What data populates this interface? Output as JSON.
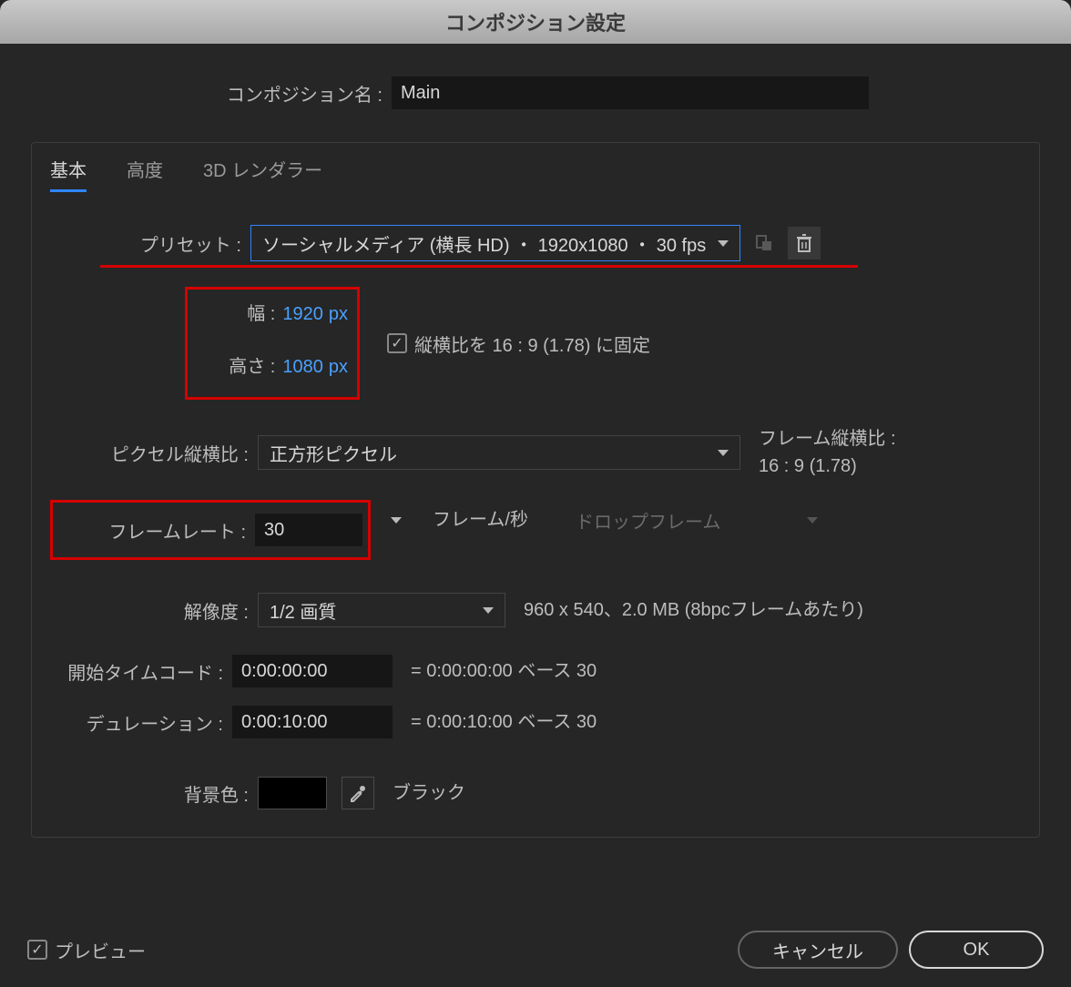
{
  "window": {
    "title": "コンポジション設定"
  },
  "name": {
    "label": "コンポジション名 :",
    "value": "Main"
  },
  "tabs": {
    "basic": "基本",
    "advanced": "高度",
    "threeD": "3D レンダラー"
  },
  "preset": {
    "label": "プリセット :",
    "value": "ソーシャルメディア (横長 HD) ・ 1920x1080 ・ 30 fps"
  },
  "dims": {
    "widthLabel": "幅 :",
    "width": "1920",
    "heightLabel": "高さ :",
    "height": "1080",
    "unit": "px",
    "lockText": "縦横比を 16 : 9 (1.78) に固定"
  },
  "pixelAspect": {
    "label": "ピクセル縦横比 :",
    "value": "正方形ピクセル",
    "infoLabel": "フレーム縦横比 :",
    "infoValue": "16 : 9 (1.78)"
  },
  "frameRate": {
    "label": "フレームレート :",
    "value": "30",
    "fpsLabel": "フレーム/秒",
    "dropFrame": "ドロップフレーム"
  },
  "resolution": {
    "label": "解像度 :",
    "value": "1/2 画質",
    "info": "960 x 540、2.0 MB (8bpcフレームあたり)"
  },
  "startTimecode": {
    "label": "開始タイムコード :",
    "value": "0:00:00:00",
    "info": "= 0:00:00:00  ベース 30"
  },
  "duration": {
    "label": "デュレーション :",
    "value": "0:00:10:00",
    "info": "= 0:00:10:00  ベース 30"
  },
  "bgColor": {
    "label": "背景色 :",
    "name": "ブラック",
    "hex": "#000000"
  },
  "footer": {
    "preview": "プレビュー",
    "cancel": "キャンセル",
    "ok": "OK"
  }
}
